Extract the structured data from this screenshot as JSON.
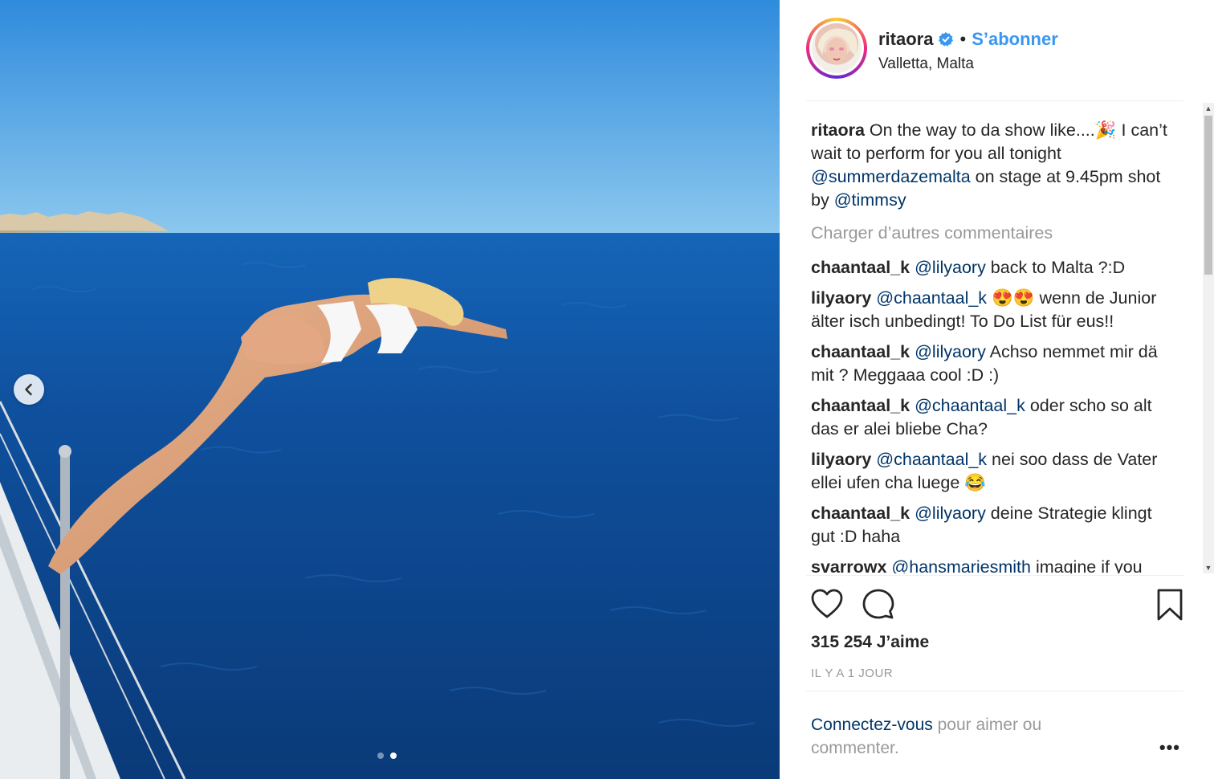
{
  "post": {
    "username": "ritaora",
    "follow_label": "S’abonner",
    "separator": "•",
    "location": "Valletta, Malta"
  },
  "caption": {
    "user": "ritaora",
    "text_1": "On the way to da show like....",
    "emoji_1": "🎉",
    "text_2": " I can’t wait to perform for you all tonight ",
    "mention_1": "@summerdazemalta",
    "text_3": " on stage at 9.45pm shot by ",
    "mention_2": "@timmsy"
  },
  "load_more": "Charger d’autres commentaires",
  "comments": [
    {
      "user": "chaantaal_k",
      "mention": "@lilyaory",
      "text": " back to Malta ?:D"
    },
    {
      "user": "lilyaory",
      "mention": "@chaantaal_k",
      "text": " 😍😍 wenn de Junior älter isch unbedingt! To Do List für eus!!"
    },
    {
      "user": "chaantaal_k",
      "mention": "@lilyaory",
      "text": " Achso nemmet mir dä mit ? Meggaaa cool :D :)"
    },
    {
      "user": "chaantaal_k",
      "mention": "@chaantaal_k",
      "text": " oder scho so alt das er alei bliebe Cha?"
    },
    {
      "user": "lilyaory",
      "mention": "@chaantaal_k",
      "text": " nei soo dass de Vater ellei ufen cha luege 😂"
    },
    {
      "user": "chaantaal_k",
      "mention": "@lilyaory",
      "text": " deine Strategie klingt gut :D haha"
    },
    {
      "user": "svarrowx",
      "mention": "@hansmariesmith",
      "text": " imagine if you"
    }
  ],
  "likes": "315 254 J’aime",
  "timestamp": "IL Y A 1 JOUR",
  "login": {
    "link": "Connectez-vous",
    "text": " pour aimer ou commenter."
  },
  "more_label": "•••",
  "carousel": {
    "current": 2,
    "total": 2
  },
  "icons": {
    "prev": "chevron-left-icon",
    "heart": "heart-icon",
    "comment": "comment-icon",
    "bookmark": "bookmark-icon",
    "verified": "verified-badge-icon"
  },
  "colors": {
    "link": "#003569",
    "follow": "#3897f0",
    "muted": "#999999",
    "verified": "#3897f0"
  }
}
